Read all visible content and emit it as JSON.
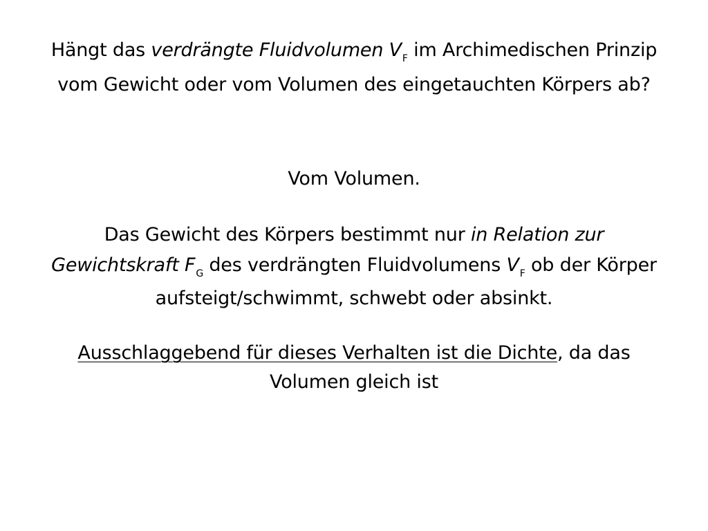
{
  "question": {
    "line1": {
      "pre": "Hängt das ",
      "italic": "verdrängte Fluidvolumen V",
      "sub": "F",
      "post": " im Archimedischen Prinzip"
    },
    "line2": "vom Gewicht oder vom Volumen des eingetauchten Körpers ab?"
  },
  "answer": {
    "short": "Vom Volumen.",
    "explanation": {
      "line1_pre": "Das Gewicht des Körpers bestimmt nur ",
      "line1_italic": "in Relation zur",
      "line2_italic": "Gewichtskraft F",
      "line2_sub_g": "G",
      "line2_mid": " des verdrängten Fluidvolumens ",
      "line2_italic_v": "V",
      "line2_sub_f": "F",
      "line2_post": " ob der Körper",
      "line3": "aufsteigt/schwimmt, schwebt oder absinkt."
    },
    "conclusion": {
      "underlined": "Ausschlaggebend für dieses Verhalten ist die Dichte",
      "rest_line1": ", da das",
      "line2": "Volumen gleich ist"
    }
  }
}
